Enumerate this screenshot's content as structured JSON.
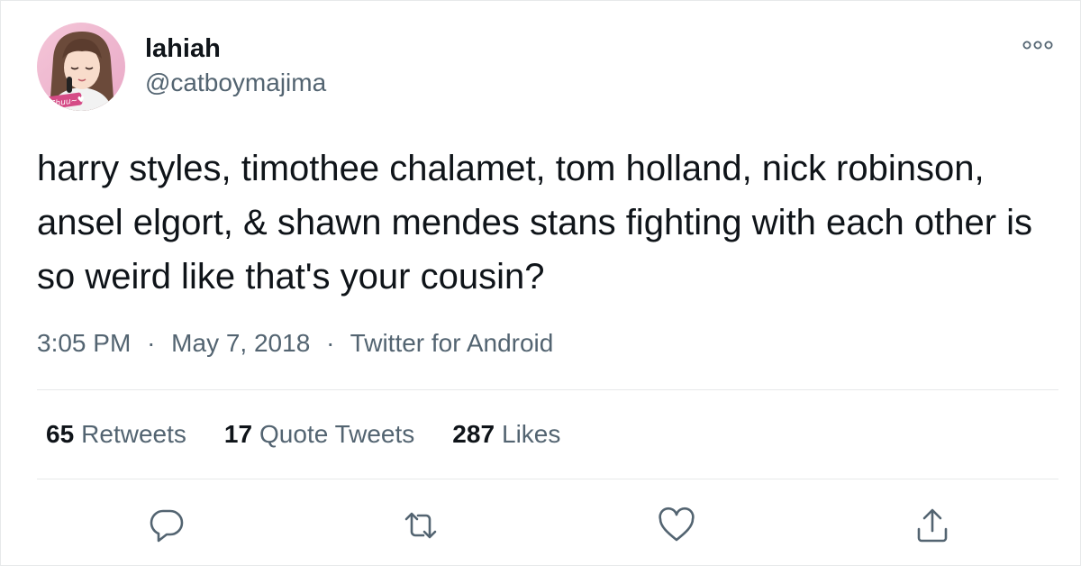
{
  "tweet": {
    "display_name": "lahiah",
    "handle": "@catboymajima",
    "avatar_caption": "Chuu~♥",
    "text": "harry styles, timothee chalamet, tom holland, nick robinson, ansel elgort, & shawn mendes stans fighting with each other is so weird like that's your cousin?",
    "time": "3:05 PM",
    "date": "May 7, 2018",
    "source": "Twitter for Android",
    "separator": "·"
  },
  "stats": {
    "retweets": {
      "count": "65",
      "label": "Retweets"
    },
    "quotes": {
      "count": "17",
      "label": "Quote Tweets"
    },
    "likes": {
      "count": "287",
      "label": "Likes"
    }
  },
  "icons": {
    "more": "more-icon",
    "reply": "reply-icon",
    "retweet": "retweet-icon",
    "like": "heart-icon",
    "share": "share-icon"
  },
  "colors": {
    "text_primary": "#0f1419",
    "text_secondary": "#536471",
    "divider": "#e7e9ea",
    "background": "#ffffff"
  }
}
